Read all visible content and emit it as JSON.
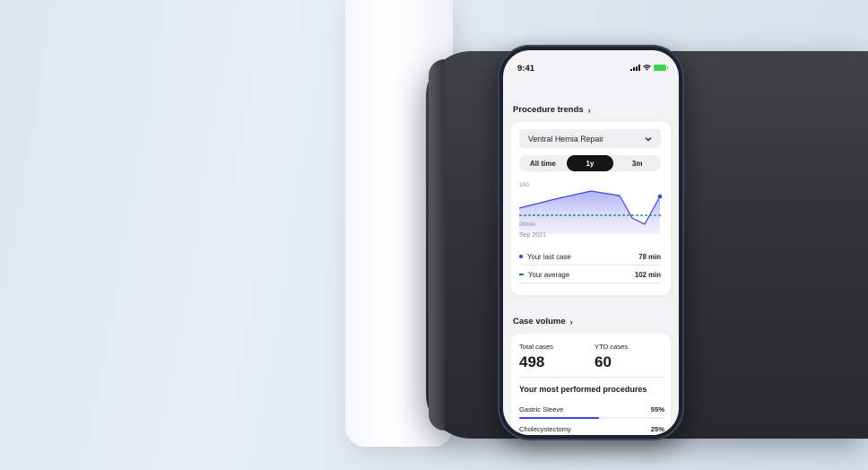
{
  "status_bar": {
    "time": "9:41"
  },
  "procedure_trends": {
    "title": "Procedure trends",
    "selected_procedure": "Ventral Hernia Repair",
    "ranges": [
      "All time",
      "1y",
      "3m"
    ],
    "active_range": "1y",
    "chart_data": {
      "type": "area",
      "y_top_label": "100",
      "y_bottom_label": "20min",
      "x_start_label": "Sep 2021",
      "average_line_color": "#1d7a4c",
      "series_color": "#3b46d8"
    },
    "legend": [
      {
        "label": "Your last case",
        "value": "78 min"
      },
      {
        "label": "Your average",
        "value": "102 min"
      }
    ]
  },
  "case_volume": {
    "title": "Case volume",
    "total_label": "Total cases",
    "total_value": "498",
    "ytd_label": "YTD cases",
    "ytd_value": "60",
    "most_performed_title": "Your most performed procedures",
    "procedures": [
      {
        "name": "Gastric Sleeve",
        "pct_label": "55%",
        "fraction": 0.55
      },
      {
        "name": "Cholecystectomy",
        "pct_label": "25%",
        "fraction": 0.25
      }
    ]
  }
}
